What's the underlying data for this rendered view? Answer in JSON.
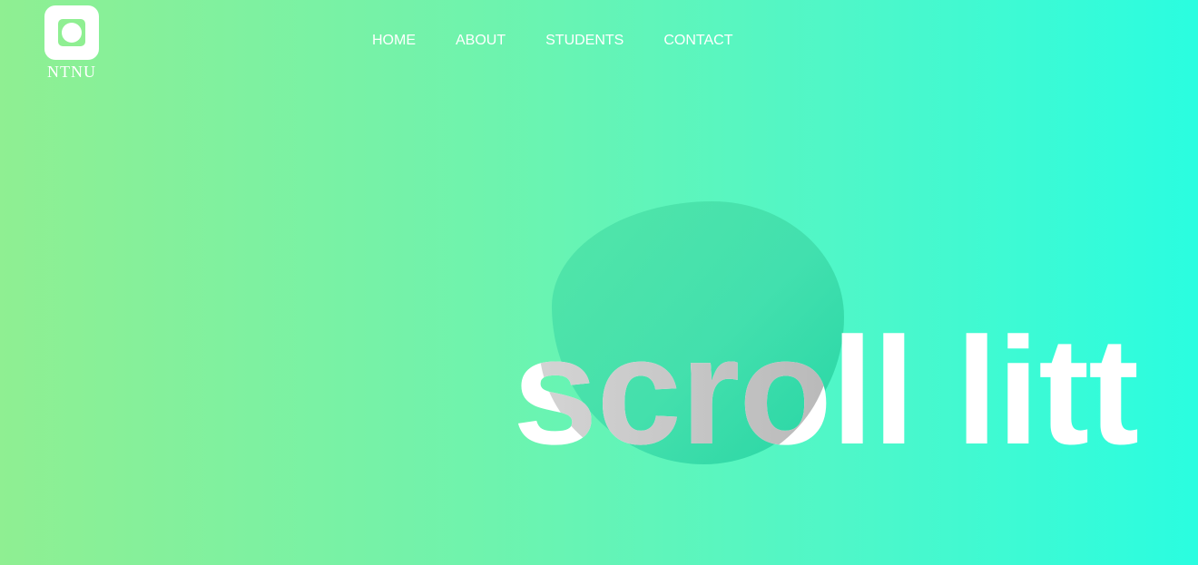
{
  "logo": {
    "text": "NTNU"
  },
  "nav": {
    "items": [
      {
        "label": "HOME"
      },
      {
        "label": "ABOUT"
      },
      {
        "label": "STUDENTS"
      },
      {
        "label": "CONTACT"
      }
    ]
  },
  "hero": {
    "text": "scroll litt"
  },
  "colors": {
    "gradient_start": "#8fef92",
    "gradient_end": "#2afde0",
    "text": "#ffffff"
  }
}
